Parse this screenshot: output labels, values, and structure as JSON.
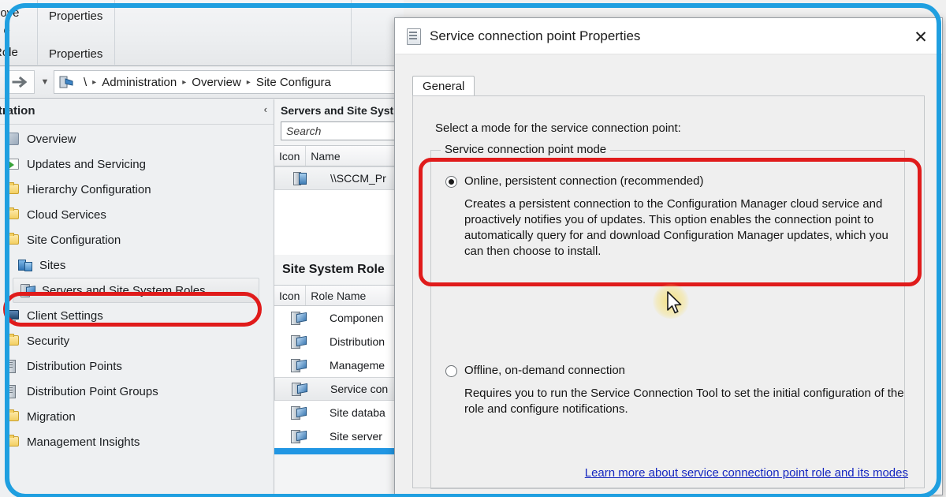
{
  "ribbon": {
    "items": [
      {
        "label": "nove"
      },
      {
        "label": "o e"
      },
      {
        "label": "Role"
      },
      {
        "label": "Properties"
      },
      {
        "label": "Properties"
      }
    ]
  },
  "breadcrumb": {
    "forward_icon": "forward-arrow-icon",
    "dropdown_icon": "chevron-down-icon",
    "root_icon": "console-node-icon",
    "root": "\\",
    "separator": "▸",
    "segments": [
      "Administration",
      "Overview",
      "Site Configura"
    ]
  },
  "navpane": {
    "title": "inistration",
    "collapse_icon": "‹",
    "items": [
      {
        "label": "Overview",
        "icon": "overview-icon",
        "indent": false,
        "selected": false
      },
      {
        "label": "Updates and Servicing",
        "icon": "updates-icon",
        "indent": false,
        "selected": false
      },
      {
        "label": "Hierarchy Configuration",
        "icon": "folder-icon",
        "indent": false,
        "selected": false
      },
      {
        "label": "Cloud Services",
        "icon": "folder-icon",
        "indent": false,
        "selected": false
      },
      {
        "label": "Site Configuration",
        "icon": "folder-icon",
        "indent": false,
        "selected": false
      },
      {
        "label": "Sites",
        "icon": "sites-icon",
        "indent": true,
        "selected": false
      },
      {
        "label": "Servers and Site System Roles",
        "icon": "server-role-icon",
        "indent": true,
        "selected": true
      },
      {
        "label": "Client Settings",
        "icon": "client-icon",
        "indent": false,
        "selected": false
      },
      {
        "label": "Security",
        "icon": "folder-icon",
        "indent": false,
        "selected": false
      },
      {
        "label": "Distribution Points",
        "icon": "distribution-point-icon",
        "indent": false,
        "selected": false
      },
      {
        "label": "Distribution Point Groups",
        "icon": "distribution-point-icon",
        "indent": false,
        "selected": false
      },
      {
        "label": "Migration",
        "icon": "folder-icon",
        "indent": false,
        "selected": false
      },
      {
        "label": "Management Insights",
        "icon": "folder-icon",
        "indent": false,
        "selected": false
      }
    ]
  },
  "midpane": {
    "title": "Servers and Site Syst",
    "search_placeholder": "Search",
    "servers_grid": {
      "columns": [
        "Icon",
        "Name"
      ],
      "rows": [
        {
          "name": "\\\\SCCM_Pr",
          "selected": true
        }
      ]
    },
    "roles_title": "Site System Role",
    "roles_grid": {
      "columns": [
        "Icon",
        "Role Name"
      ],
      "rows": [
        {
          "name": "Componen",
          "selected": false
        },
        {
          "name": "Distribution",
          "selected": false
        },
        {
          "name": "Manageme",
          "selected": false
        },
        {
          "name": "Service con",
          "selected": true
        },
        {
          "name": "Site databa",
          "selected": false
        },
        {
          "name": "Site server",
          "selected": false
        }
      ]
    }
  },
  "dialog": {
    "title": "Service connection point Properties",
    "title_icon": "properties-icon",
    "close_icon": "close-icon",
    "tabs": [
      {
        "label": "General",
        "active": true
      }
    ],
    "prompt": "Select a mode for the service connection point:",
    "groupbox_legend": "Service connection point mode",
    "options": [
      {
        "label": "Online, persistent connection (recommended)",
        "selected": true,
        "description": "Creates a persistent connection to the Configuration Manager cloud service and proactively notifies you of updates. This option enables the connection point to automatically query for and download Configuration Manager updates, which you can then choose to install."
      },
      {
        "label": "Offline, on-demand connection",
        "selected": false,
        "description": "Requires you to run the Service Connection Tool to set the initial configuration of the role and configure notifications."
      }
    ],
    "help_link": "Learn more about service connection point role and its modes"
  },
  "annotations": {
    "highlight_color": "#e01b1b",
    "frame_color": "#1f9fe0",
    "cursor_glow_color": "#f6df6a"
  }
}
